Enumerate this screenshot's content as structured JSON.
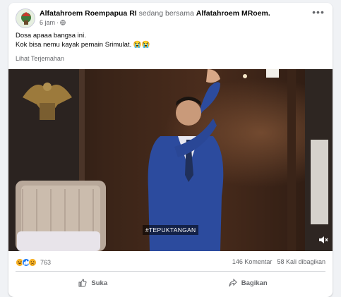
{
  "post": {
    "author": "Alfatahroem Roempapua RI",
    "with_text": "sedang bersama",
    "tagged": "Alfatahroem MRoem.",
    "time": "6 jam",
    "privacy_sep": "·",
    "text_line1": "Dosa apaaa bangsa ini.",
    "text_line2": "Kok bisa nemu kayak pemain Srimulat. 😭😭",
    "translate": "Lihat Terjemahan"
  },
  "video": {
    "caption_tag": "#TEPUKTANGAN"
  },
  "stats": {
    "reactions_count": "763",
    "comments": "146 Komentar",
    "shares": "58 Kali dibagikan",
    "reaction_icons": [
      "laugh-icon",
      "like-icon",
      "sad-icon"
    ]
  },
  "actions": {
    "like": "Suka",
    "share": "Bagikan"
  },
  "colors": {
    "link_blue": "#1877f2",
    "secondary_text": "#65676b",
    "background": "#f0f2f5"
  }
}
